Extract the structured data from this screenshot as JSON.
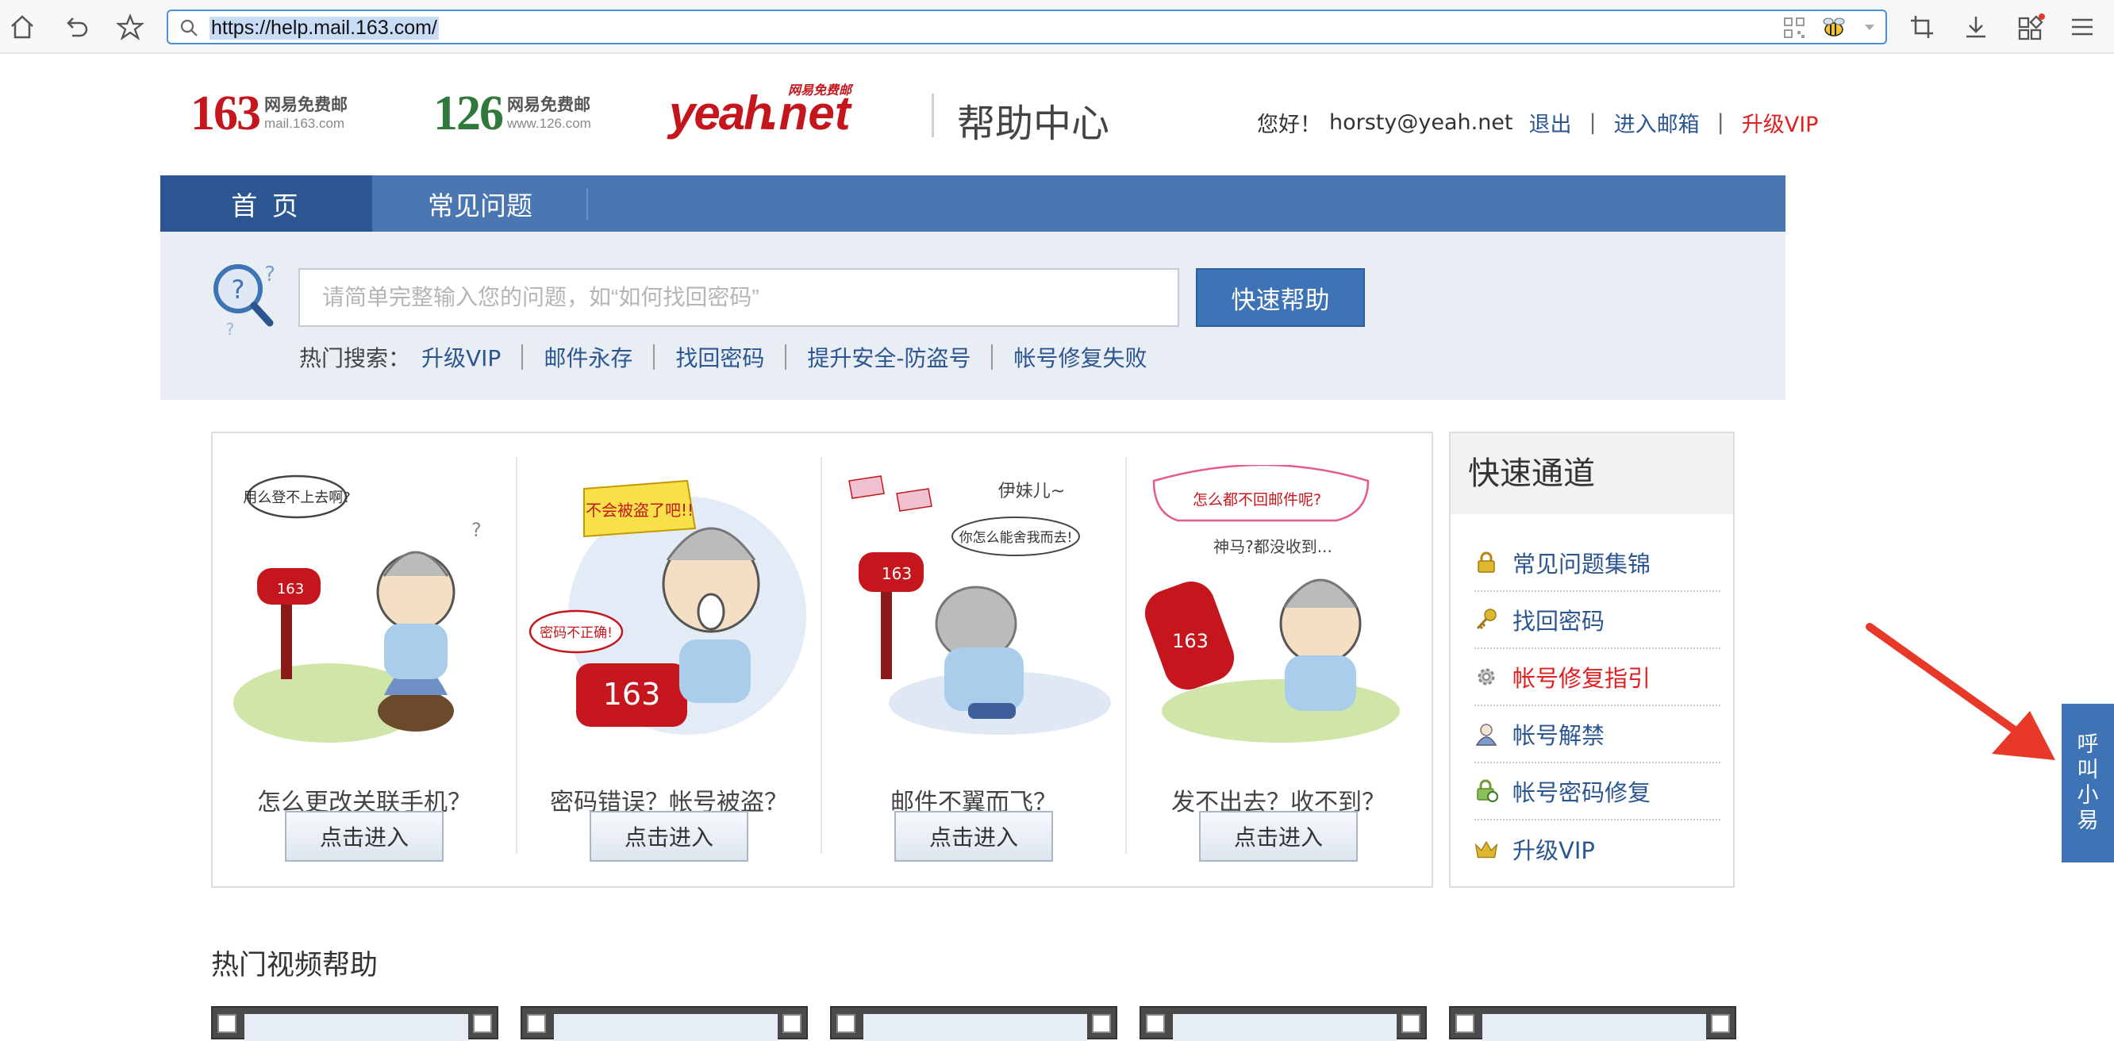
{
  "browser": {
    "url": "https://help.mail.163.com/"
  },
  "header": {
    "logos": [
      {
        "num": "163",
        "line1": "网易免费邮",
        "line2": "mail.163.com",
        "color": "#c4161c"
      },
      {
        "num": "126",
        "line1": "网易免费邮",
        "line2": "www.126.com",
        "color": "#2f7a3a"
      },
      {
        "word": "yeah",
        "dot": ".net",
        "tag": "网易免费邮",
        "color": "#c4161c"
      }
    ],
    "site_title": "帮助中心",
    "greeting": "您好！",
    "user_email": "horsty@yeah.net",
    "logout": "退出",
    "sep": "|",
    "enter_mailbox": "进入邮箱",
    "upgrade_vip": "升级VIP"
  },
  "nav": {
    "home": "首 页",
    "faq": "常见问题"
  },
  "search": {
    "placeholder": "请简单完整输入您的问题，如“如何找回密码”",
    "button": "快速帮助",
    "hot_label": "热门搜索：",
    "hot_links": [
      "升级VIP",
      "邮件永存",
      "找回密码",
      "提升安全-防盗号",
      "帐号修复失败"
    ]
  },
  "cards": [
    {
      "caption": "怎么更改关联手机？",
      "button": "点击进入"
    },
    {
      "caption": "密码错误？帐号被盗？",
      "button": "点击进入"
    },
    {
      "caption": "邮件不翼而飞？",
      "button": "点击进入"
    },
    {
      "caption": "发不出去？收不到？",
      "button": "点击进入"
    }
  ],
  "quick": {
    "title": "快速通道",
    "items": [
      {
        "label": "常见问题集锦",
        "icon": "lock-icon",
        "color": "#2c5691"
      },
      {
        "label": "找回密码",
        "icon": "key-icon",
        "color": "#2c5691"
      },
      {
        "label": "帐号修复指引",
        "icon": "gear-icon",
        "color": "#e02020"
      },
      {
        "label": "帐号解禁",
        "icon": "user-icon",
        "color": "#2c5691"
      },
      {
        "label": "帐号密码修复",
        "icon": "lock-refresh-icon",
        "color": "#2c5691"
      },
      {
        "label": "升级VIP",
        "icon": "crown-icon",
        "color": "#2c5691"
      }
    ]
  },
  "videos": {
    "title": "热门视频帮助"
  },
  "float_help": {
    "chars": [
      "呼",
      "叫",
      "小",
      "易"
    ]
  },
  "colors": {
    "nav_bg": "#4a77b2",
    "nav_active": "#2c5691",
    "link": "#2c5691",
    "vip_red": "#e02020",
    "arrow_red": "#e8382a"
  }
}
